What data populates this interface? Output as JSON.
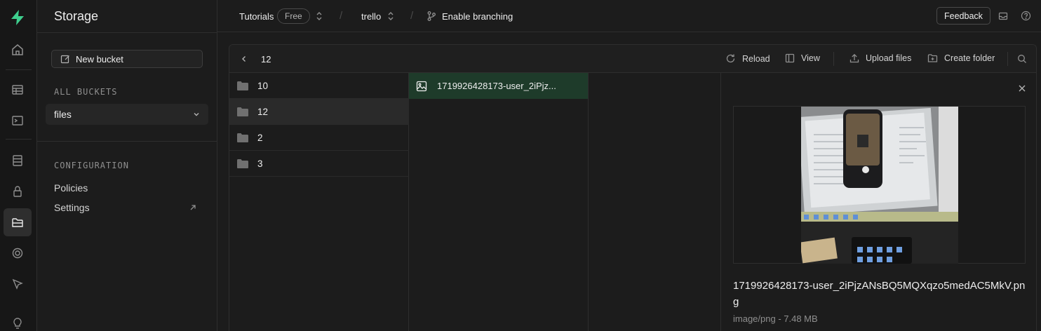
{
  "rail": {
    "icons": [
      "logo-icon",
      "home-icon",
      "table-editor-icon",
      "sql-editor-icon",
      "database-icon",
      "auth-icon",
      "storage-icon",
      "edge-functions-icon",
      "realtime-icon",
      "advisors-icon"
    ]
  },
  "sidebar": {
    "title": "Storage",
    "new_bucket_label": "New bucket",
    "all_buckets_heading": "ALL BUCKETS",
    "buckets": [
      {
        "label": "files"
      }
    ],
    "configuration_heading": "CONFIGURATION",
    "config_links": [
      {
        "label": "Policies"
      },
      {
        "label": "Settings"
      }
    ]
  },
  "topbar": {
    "org": "Tutorials",
    "plan_badge": "Free",
    "project": "trello",
    "branching_label": "Enable branching",
    "feedback_label": "Feedback"
  },
  "explorer": {
    "current_path": "12",
    "actions": {
      "reload": "Reload",
      "view": "View",
      "upload": "Upload files",
      "create_folder": "Create folder"
    },
    "folders": [
      {
        "name": "10"
      },
      {
        "name": "12"
      },
      {
        "name": "2"
      },
      {
        "name": "3"
      }
    ],
    "selected_folder": "12",
    "files": [
      {
        "name": "1719926428173-user_2iPjz..."
      }
    ]
  },
  "preview": {
    "file_name": "1719926428173-user_2iPjzANsBQ5MQXqzo5medAC5MkV.png",
    "meta": "image/png - 7.48 MB"
  },
  "colors": {
    "brand_green": "#3ecf8e",
    "selected_file_bg": "#1e3b2a"
  }
}
